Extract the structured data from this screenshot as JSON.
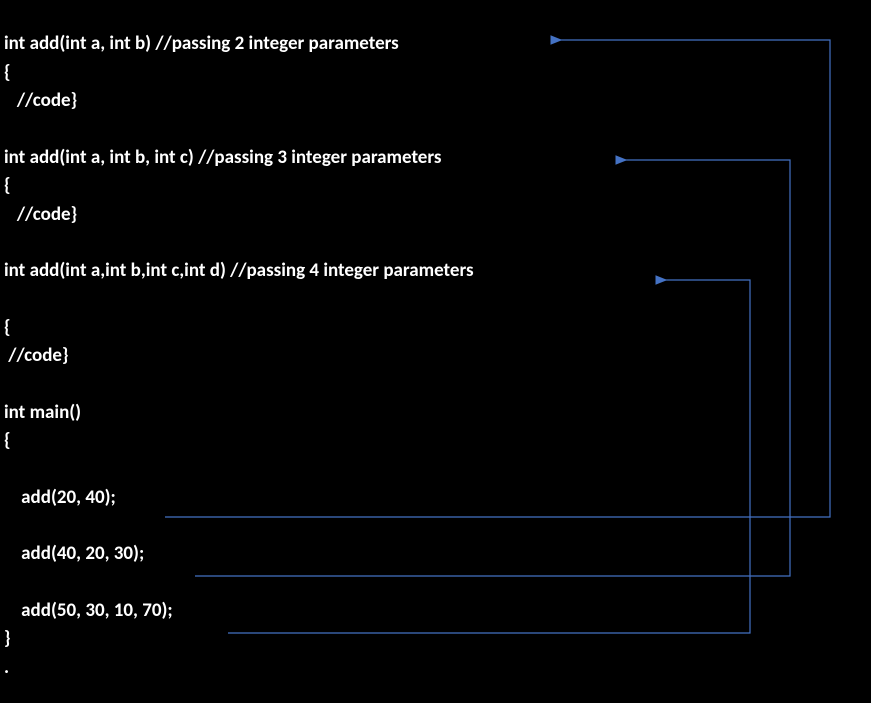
{
  "code": {
    "func1_sig": "int add(int a, int b) //passing 2 integer parameters",
    "brace_open": "{",
    "code_comment": "   //code}",
    "code_comment2": " //code}",
    "func2_sig": "int add(int a, int b, int c) //passing 3 integer parameters",
    "func3_sig": "int add(int a,int b,int c,int d) //passing 4 integer parameters",
    "main_sig": "int main()",
    "call1": "    add(20, 40);",
    "call2": "    add(40, 20, 30);",
    "call3": "    add(50, 30, 10, 70);",
    "brace_close": "}",
    "dot": "."
  },
  "arrows": {
    "color": "#4472C4",
    "strokeWidth": "1.2"
  },
  "diagram_data": {
    "type": "function-overloading-diagram",
    "functions": [
      {
        "name": "add",
        "params": [
          "int a",
          "int b"
        ],
        "comment": "passing 2 integer parameters"
      },
      {
        "name": "add",
        "params": [
          "int a",
          "int b",
          "int c"
        ],
        "comment": "passing 3 integer parameters"
      },
      {
        "name": "add",
        "params": [
          "int a",
          "int b",
          "int c",
          "int d"
        ],
        "comment": "passing 4 integer parameters"
      }
    ],
    "calls": [
      {
        "call": "add(20, 40)",
        "maps_to_function_index": 0
      },
      {
        "call": "add(40, 20, 30)",
        "maps_to_function_index": 1
      },
      {
        "call": "add(50, 30, 10, 70)",
        "maps_to_function_index": 2
      }
    ]
  }
}
